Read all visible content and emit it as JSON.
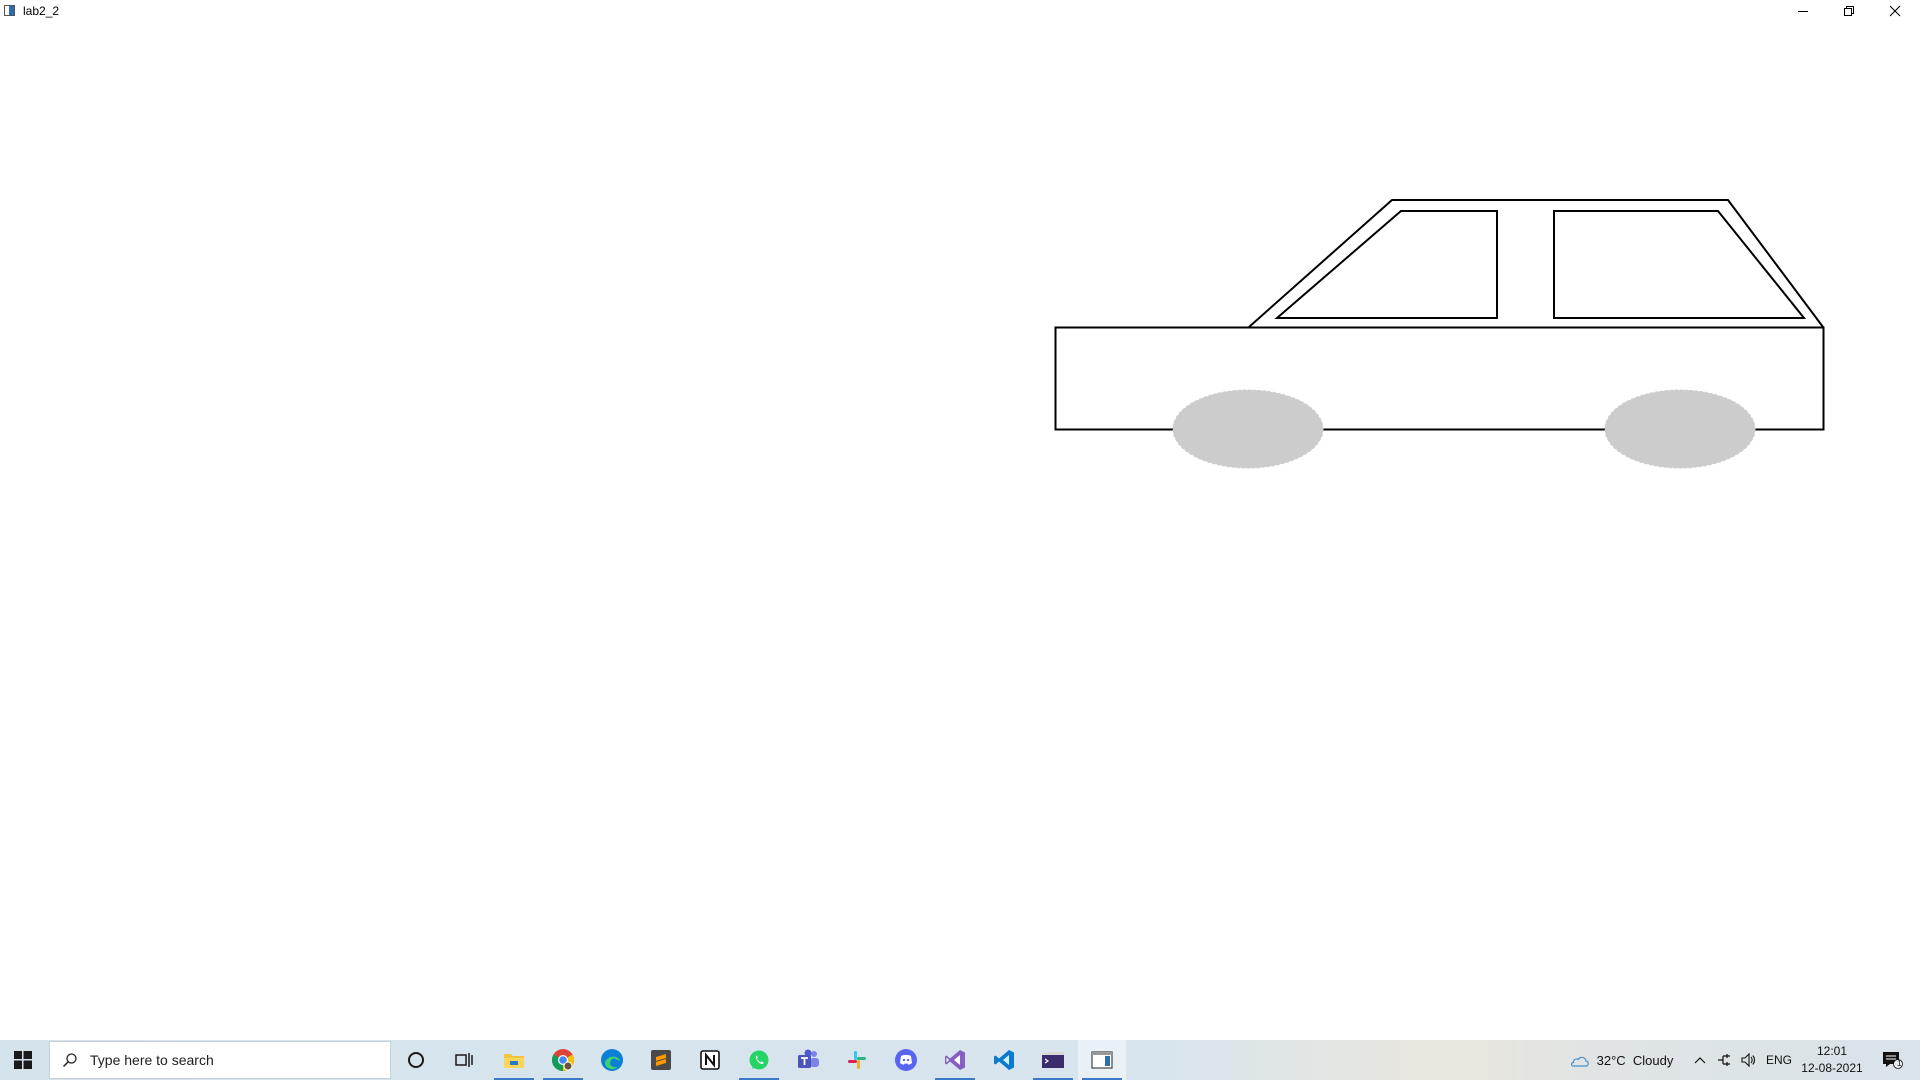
{
  "window": {
    "title": "lab2_2",
    "minimize_glyph": "—",
    "restore_glyph": "❐",
    "close_glyph": "✕"
  },
  "canvas": {
    "background": "#ffffff",
    "car": {
      "stroke": "#000000",
      "wheel_fill": "#cccccc"
    }
  },
  "taskbar": {
    "search_placeholder": "Type here to search",
    "apps": [
      {
        "name": "cortana-icon",
        "active": false
      },
      {
        "name": "task-view-icon",
        "active": false
      },
      {
        "name": "file-explorer-icon",
        "active": true
      },
      {
        "name": "chrome-icon",
        "active": true
      },
      {
        "name": "edge-icon",
        "active": false
      },
      {
        "name": "sublime-text-icon",
        "active": false
      },
      {
        "name": "notion-icon",
        "active": false
      },
      {
        "name": "whatsapp-icon",
        "active": true
      },
      {
        "name": "teams-icon",
        "active": false
      },
      {
        "name": "slack-icon",
        "active": false
      },
      {
        "name": "discord-icon",
        "active": false
      },
      {
        "name": "visual-studio-icon",
        "active": true
      },
      {
        "name": "vscode-icon",
        "active": false
      },
      {
        "name": "terminal-icon",
        "active": true
      },
      {
        "name": "app-window-icon",
        "active": true
      }
    ],
    "tray": {
      "weather": "32°C  Cloudy",
      "language": "ENG",
      "time": "12:01",
      "date": "12-08-2021",
      "notification_count": "1"
    },
    "accent": "#3b7ac7"
  }
}
